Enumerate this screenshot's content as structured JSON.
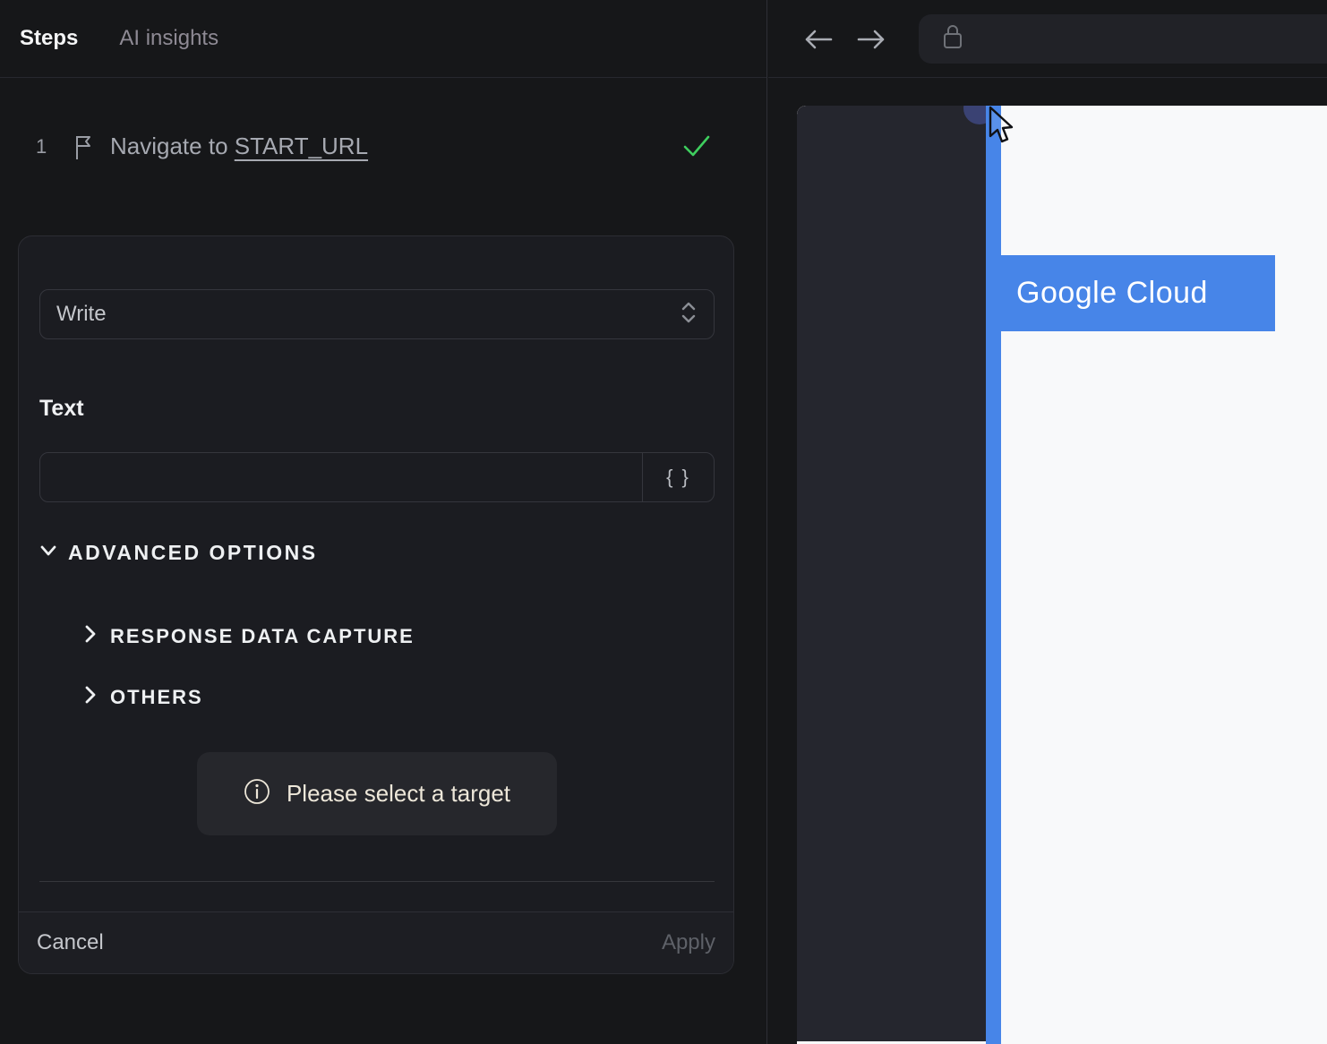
{
  "left_panel": {
    "tabs": [
      {
        "label": "Steps"
      },
      {
        "label": "AI insights"
      }
    ],
    "step": {
      "index": "1",
      "text_prefix": "Navigate to ",
      "text_link": "START_URL"
    },
    "editor": {
      "action_select": {
        "value": "Write"
      },
      "text_label": "Text",
      "text_input": {
        "value": "",
        "placeholder": ""
      },
      "braces_label": "{ }",
      "advanced_options_label": "ADVANCED OPTIONS",
      "sections": [
        {
          "label": "RESPONSE DATA CAPTURE"
        },
        {
          "label": "OTHERS"
        }
      ],
      "target_hint": "Please select a target",
      "cancel_label": "Cancel",
      "apply_label": "Apply"
    }
  },
  "browser": {
    "address_bar": {
      "value": "",
      "placeholder": ""
    },
    "page": {
      "brand_text": "Google Cloud"
    }
  },
  "colors": {
    "accent_blue": "#4785e8",
    "success_green": "#3ece5e",
    "panel_bg": "#161719",
    "card_bg": "#1b1c21",
    "pill_bg": "#26272c",
    "pill_text": "#ede7d9",
    "preview_sidebar": "#25262e",
    "preview_content": "#f8f9fa",
    "target_dot": "#3a4273"
  }
}
